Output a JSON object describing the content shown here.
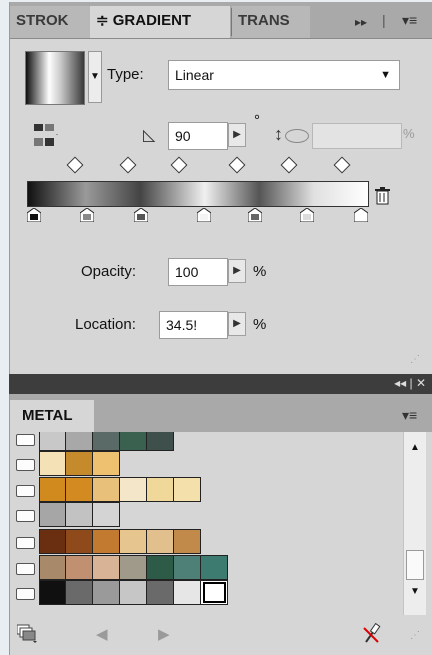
{
  "tabs": [
    {
      "label": "STROK",
      "state": "inactive"
    },
    {
      "label": "≑ GRADIENT",
      "state": "active"
    },
    {
      "label": "TRANS",
      "state": "inactive"
    }
  ],
  "tab_icons": {
    "more": "double-arrow-right-icon",
    "menu": "panel-menu-icon"
  },
  "gradient": {
    "type_label": "Type:",
    "type_value": "Linear",
    "angle_value": "90",
    "angle_unit": "°",
    "aspect_value": "",
    "aspect_unit": "%",
    "opacity_label": "Opacity:",
    "opacity_value": "100",
    "opacity_unit": "%",
    "location_label": "Location:",
    "location_value": "34.5!",
    "location_unit": "%"
  },
  "swatches_header": {
    "title": "METAL",
    "collapse_icons": "◂◂ | ✕"
  },
  "colors": {
    "panel_bg": "#d6d6d6",
    "tab_bg": "#a9a9a9",
    "page_bg": "#e9eef3"
  },
  "swatch_rows": [
    [
      "#c8c8c8",
      "#a8a8a8",
      "#5a6a66",
      "#3a6050",
      "#3e4f4c"
    ],
    [
      "#f4e2b6",
      "#c58a2b",
      "#eec171"
    ],
    [
      "#d08a1d",
      "#d38a20",
      "#e9c07a",
      "#f4e6c8",
      "#f0d89a",
      "#f3e0aa"
    ],
    [
      "#a6a6a6",
      "#c2c2c2",
      "#d4d4d4"
    ],
    [
      "#6a2e10",
      "#8f4a1c",
      "#c27a30",
      "#e7c58e",
      "#e2c08e",
      "#c28a4a"
    ],
    [
      "#a88a6a",
      "#c09070",
      "#d9b396",
      "#a09a8a",
      "#2e5a48",
      "#4f8078",
      "#3d7a70"
    ],
    [
      "#101010",
      "#6a6a6a",
      "#9a9a9a",
      "#c6c6c6",
      "#6a6a6a",
      "#e6e6e6",
      "#ffffff"
    ]
  ]
}
